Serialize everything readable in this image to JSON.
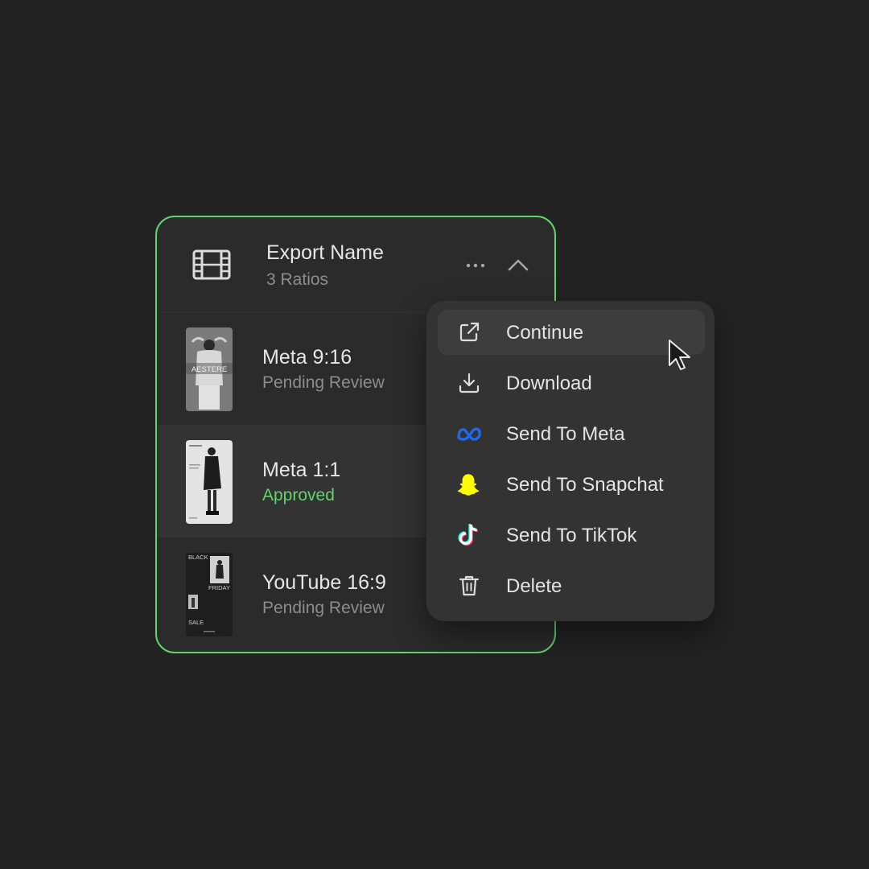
{
  "export": {
    "title": "Export Name",
    "subtitle": "3 Ratios",
    "icon": "film-icon"
  },
  "rows": [
    {
      "title": "Meta 9:16",
      "status": "Pending Review",
      "thumb_text": "AESTERE"
    },
    {
      "title": "Meta 1:1",
      "status": "Approved"
    },
    {
      "title": "YouTube 16:9",
      "status": "Pending Review",
      "thumb_text": [
        "BLACK",
        "FRIDAY",
        "SALE"
      ]
    }
  ],
  "menu": {
    "items": [
      {
        "label": "Continue",
        "icon": "external-link-icon"
      },
      {
        "label": "Download",
        "icon": "download-icon"
      },
      {
        "label": "Send To Meta",
        "icon": "meta-icon"
      },
      {
        "label": "Send To Snapchat",
        "icon": "snapchat-icon"
      },
      {
        "label": "Send To TikTok",
        "icon": "tiktok-icon"
      },
      {
        "label": "Delete",
        "icon": "trash-icon"
      }
    ]
  },
  "colors": {
    "background": "#232323",
    "card": "#2b2b2b",
    "accent_green": "#5fd66b",
    "menu": "#333333",
    "meta_blue": "#1d6bf3",
    "snapchat_yellow": "#fffc00"
  }
}
